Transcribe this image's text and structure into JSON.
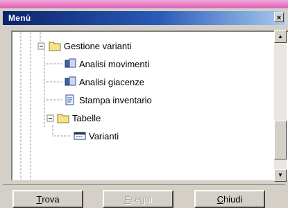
{
  "window": {
    "title": "Menù"
  },
  "tree": {
    "items": [
      {
        "label": "Gestione varianti",
        "icon": "folder-icon",
        "disabled": false
      },
      {
        "label": "Analisi movimenti",
        "icon": "program-icon",
        "disabled": false
      },
      {
        "label": "Analisi giacenze",
        "icon": "program-icon",
        "disabled": false
      },
      {
        "label": "Stampa inventario",
        "icon": "report-icon",
        "disabled": false
      },
      {
        "label": "Tabelle",
        "icon": "folder-icon",
        "disabled": false
      },
      {
        "label": "Varianti",
        "icon": "table-icon",
        "disabled": false
      }
    ]
  },
  "buttons": {
    "find": {
      "accel": "T",
      "rest": "rova"
    },
    "run": {
      "accel": "E",
      "rest": "segui"
    },
    "close": {
      "accel": "C",
      "rest": "hiudi"
    }
  }
}
